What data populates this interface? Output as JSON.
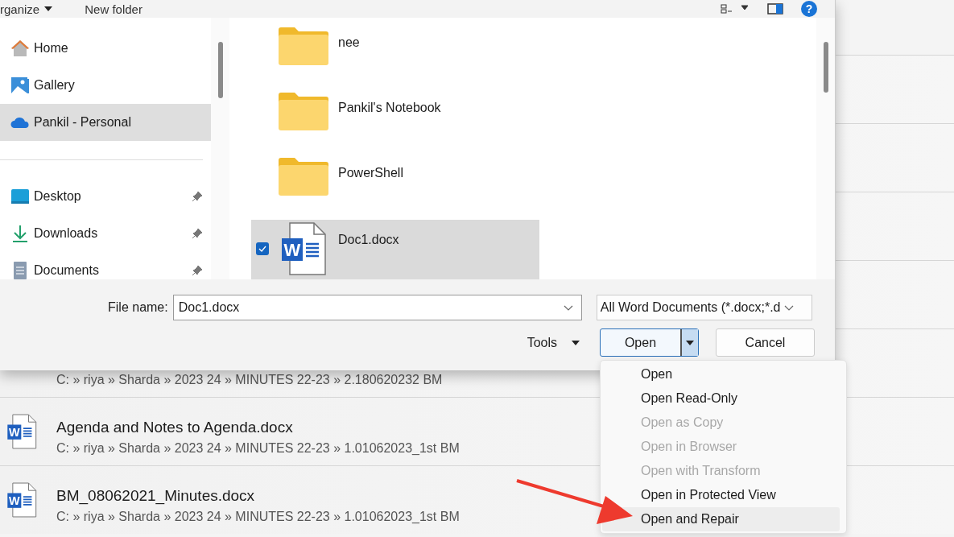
{
  "recent_files": [
    {
      "path": "C: » riya » Sharda » 2023 24 » MINUTES 22-23 » 2.180620232 BM"
    },
    {
      "name": "Agenda and Notes to Agenda.docx",
      "path": "C: » riya » Sharda » 2023 24 » MINUTES 22-23 » 1.01062023_1st BM",
      "kind": "word",
      "badge": "W"
    },
    {
      "name": "BM_08062021_Minutes.docx",
      "path": "C: » riya » Sharda » 2023 24 » MINUTES 22-23 » 1.01062023_1st BM",
      "kind": "word",
      "badge": "W"
    }
  ],
  "dialog": {
    "toolbar": {
      "organize": "rganize",
      "new_folder": "New folder",
      "help": "?"
    },
    "nav": [
      {
        "label": "Home",
        "kind": "home",
        "selected": false,
        "pinned": false
      },
      {
        "label": "Gallery",
        "kind": "gallery",
        "selected": false,
        "pinned": false
      },
      {
        "label": "Pankil - Personal",
        "kind": "cloud",
        "selected": true,
        "pinned": false
      },
      {
        "label": "Desktop",
        "kind": "desktop",
        "selected": false,
        "pinned": true
      },
      {
        "label": "Downloads",
        "kind": "downloads",
        "selected": false,
        "pinned": true
      },
      {
        "label": "Documents",
        "kind": "documents",
        "selected": false,
        "pinned": true
      }
    ],
    "files": [
      {
        "name": "nee",
        "kind": "folder",
        "selected": false
      },
      {
        "name": "Pankil's Notebook",
        "kind": "folder",
        "selected": false
      },
      {
        "name": "PowerShell",
        "kind": "folder",
        "selected": false
      },
      {
        "name": "Doc1.docx",
        "kind": "word",
        "badge": "W",
        "selected": true
      }
    ],
    "file_name_label": "File name:",
    "file_name": "Doc1.docx",
    "file_type": "All Word Documents (*.docx;*.d",
    "tools": "Tools",
    "open_button": "Open",
    "cancel_button": "Cancel",
    "open_menu": [
      {
        "label": "Open",
        "disabled": false,
        "selected": false
      },
      {
        "label": "Open Read-Only",
        "disabled": false,
        "selected": false
      },
      {
        "label": "Open as Copy",
        "disabled": true,
        "selected": false
      },
      {
        "label": "Open in Browser",
        "disabled": true,
        "selected": false
      },
      {
        "label": "Open with Transform",
        "disabled": true,
        "selected": false
      },
      {
        "label": "Open in Protected View",
        "disabled": false,
        "selected": false
      },
      {
        "label": "Open and Repair",
        "disabled": false,
        "selected": true
      }
    ]
  }
}
